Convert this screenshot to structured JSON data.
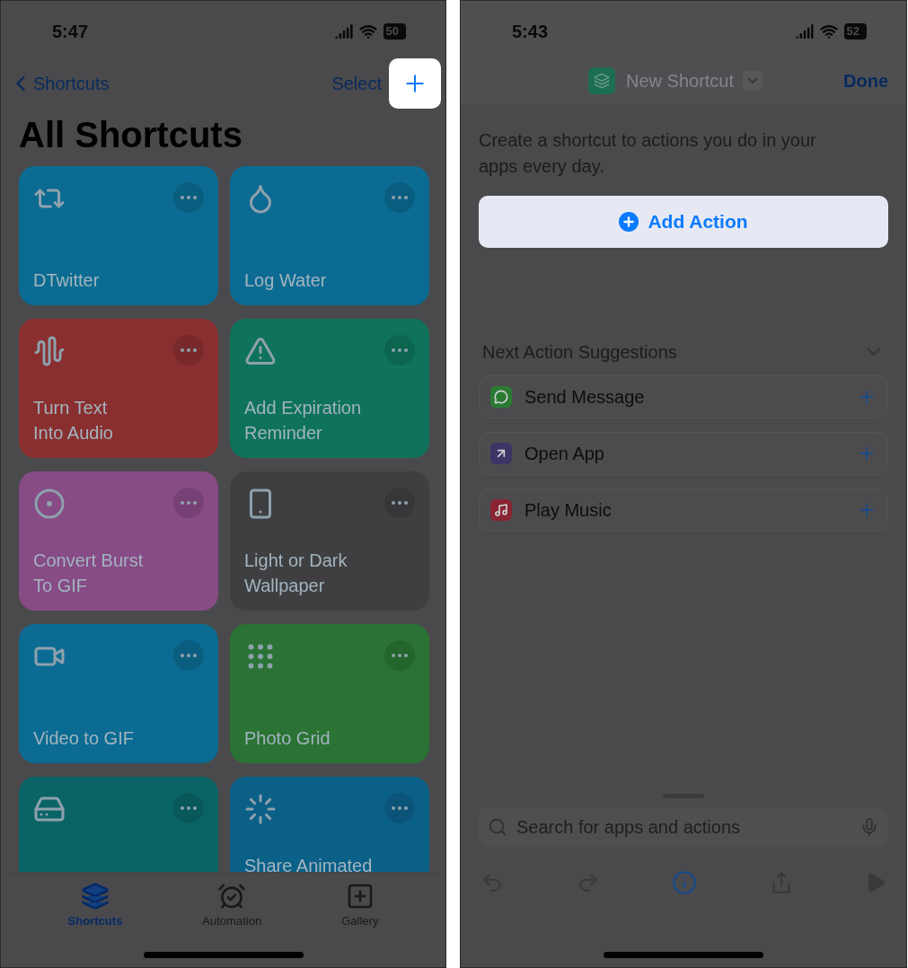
{
  "library_screen": {
    "status_bar": {
      "time": "5:47",
      "battery": "50"
    },
    "nav": {
      "back": "Shortcuts",
      "select": "Select"
    },
    "title": "All Shortcuts",
    "tiles": [
      {
        "kind": "retweet",
        "lines": [
          "DTwitter"
        ],
        "color": "#0b6b92"
      },
      {
        "kind": "drop",
        "lines": [
          "Log Water"
        ],
        "color": "#0b6b92"
      },
      {
        "kind": "waveform",
        "lines": [
          "Turn Text",
          "Into Audio"
        ],
        "color": "#8a2f2f"
      },
      {
        "kind": "warning",
        "lines": [
          "Add Expiration",
          "Reminder"
        ],
        "color": "#0e735a"
      },
      {
        "kind": "target",
        "lines": [
          "Convert Burst",
          "To GIF"
        ],
        "color": "#874b86"
      },
      {
        "kind": "phone",
        "lines": [
          "Light or Dark",
          "Wallpaper"
        ],
        "color": "#3f3f41"
      },
      {
        "kind": "video",
        "lines": [
          "Video to GIF"
        ],
        "color": "#0b6b92"
      },
      {
        "kind": "grid",
        "lines": [
          "Photo Grid"
        ],
        "color": "#2a7334"
      },
      {
        "kind": "drive",
        "color": "#0a6466"
      },
      {
        "kind": "loader",
        "lines": [
          "Share Animated"
        ],
        "color": "#0b6088"
      }
    ],
    "tabs": [
      {
        "label": "Shortcuts",
        "kind": "layers",
        "selected": true
      },
      {
        "label": "Automation",
        "kind": "clock",
        "selected": false
      },
      {
        "label": "Gallery",
        "kind": "gallery",
        "selected": false
      }
    ]
  },
  "editor_screen": {
    "status_bar": {
      "time": "5:43",
      "battery": "52"
    },
    "nav": {
      "title": "New Shortcut",
      "done": "Done"
    },
    "description": "Create a shortcut to actions you do in your apps every day.",
    "add_action": "Add Action",
    "suggestions_title": "Next Action Suggestions",
    "suggestions": [
      {
        "label": "Send Message",
        "kind": "messages"
      },
      {
        "label": "Open App",
        "kind": "app"
      },
      {
        "label": "Play Music",
        "kind": "music"
      }
    ],
    "search": {
      "placeholder": "Search for apps and actions"
    }
  }
}
